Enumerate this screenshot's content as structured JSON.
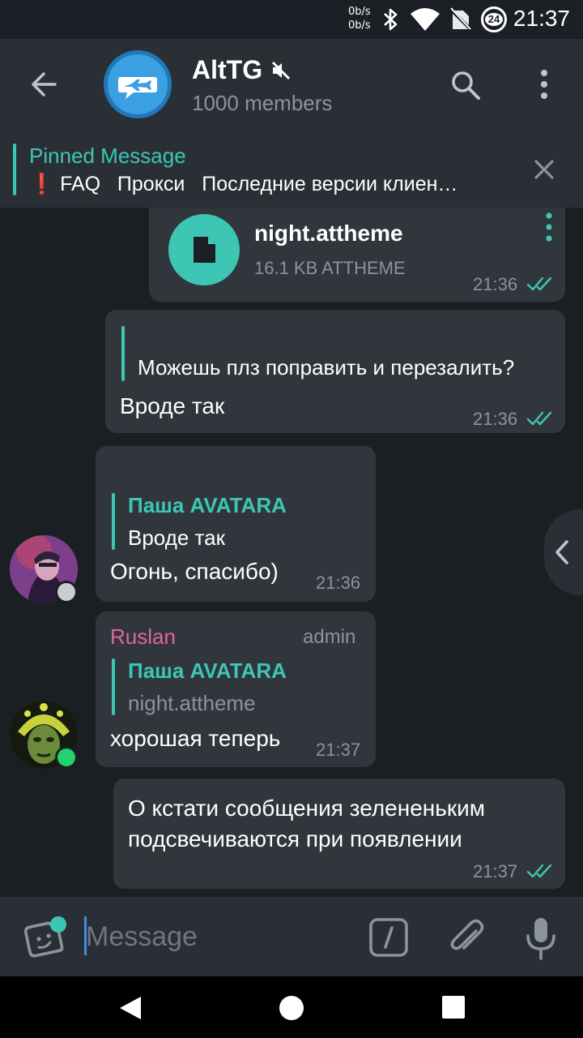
{
  "status_bar": {
    "net_up": "0b/s",
    "net_down": "0b/s",
    "data_saver_badge": "24",
    "time": "21:37",
    "icons": [
      "bluetooth-icon",
      "wifi-icon",
      "no-sim-icon",
      "data-saver-icon"
    ]
  },
  "header": {
    "title": "AltTG",
    "subtitle": "1000 members",
    "muted": true,
    "avatar_color": "#3aa0e2"
  },
  "pinned": {
    "title": "Pinned Message",
    "text": "❗ FAQ   Прокси   Последние версии клиен…"
  },
  "messages": [
    {
      "type": "file",
      "outgoing": true,
      "file_name": "night.attheme",
      "file_meta": "16.1 KB ATTHEME",
      "time": "21:36",
      "read": true
    },
    {
      "type": "reply",
      "outgoing": true,
      "quote_text": "Можешь плз поправить и перезалить?",
      "text": "Вроде так",
      "time": "21:36",
      "read": true
    },
    {
      "type": "reply",
      "outgoing": false,
      "quote_name": "Паша AVATARA",
      "quote_text": "Вроде так",
      "text": "Огонь, спасибо)",
      "time": "21:36"
    },
    {
      "type": "reply",
      "outgoing": false,
      "sender": "Ruslan",
      "sender_tag": "admin",
      "quote_name": "Паша AVATARA",
      "quote_text": "night.attheme",
      "text": "хорошая теперь",
      "time": "21:37",
      "online": true
    },
    {
      "type": "text",
      "outgoing": true,
      "text_line1": "О кстати сообщения зелененьким",
      "text_line2": "подсвечиваются при появлении",
      "time": "21:37",
      "read": true
    }
  ],
  "input": {
    "placeholder": "Message"
  },
  "colors": {
    "accent": "#3dc6b4",
    "bubble": "#31363d",
    "header": "#2a2f36",
    "background": "#1b1f24",
    "admin_name": "#e0669c",
    "online": "#22d36b"
  }
}
